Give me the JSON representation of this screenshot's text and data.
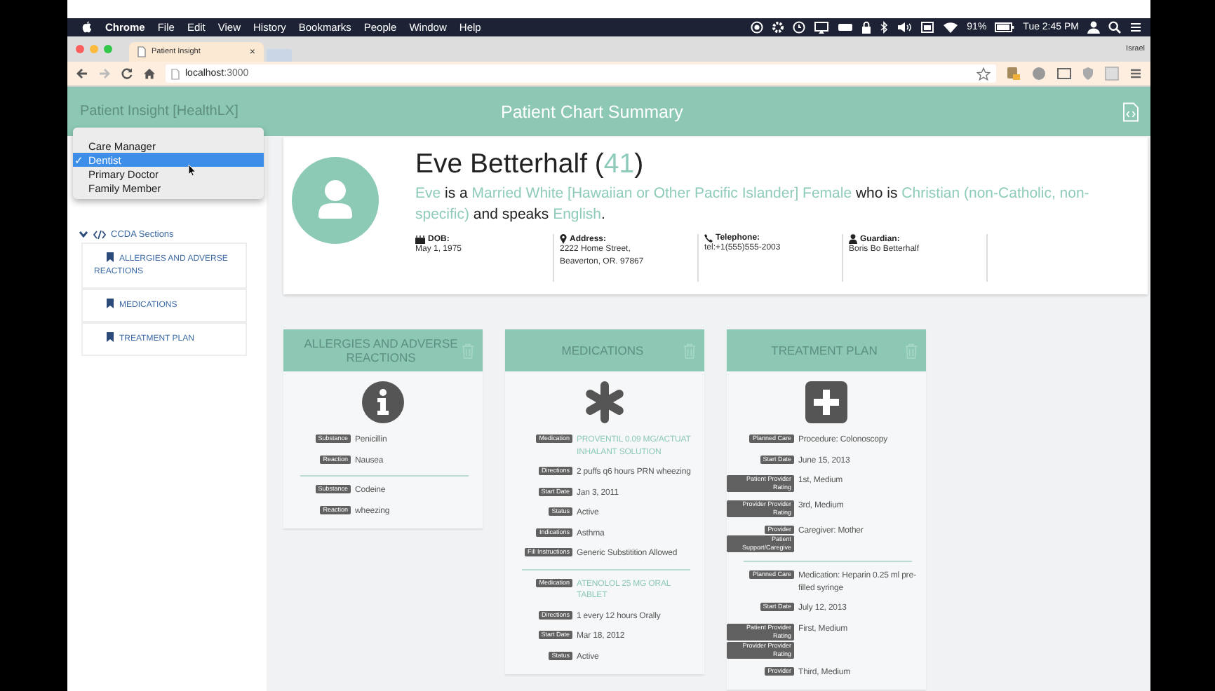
{
  "menubar": {
    "app": "Chrome",
    "items": [
      "File",
      "Edit",
      "View",
      "History",
      "Bookmarks",
      "People",
      "Window",
      "Help"
    ],
    "battery": "91%",
    "clock": "Tue 2:45 PM"
  },
  "browser": {
    "tab_title": "Patient Insight",
    "tab_close": "×",
    "profile": "Israel",
    "url": "**localhost**:3000"
  },
  "header": {
    "brand": "Patient Insight [HealthLX]",
    "title": "Patient Chart Summary"
  },
  "role_menu": {
    "options": [
      {
        "label": "Care Manager",
        "selected": false
      },
      {
        "label": "Dentist",
        "selected": true
      },
      {
        "label": "Primary Doctor",
        "selected": false
      },
      {
        "label": "Family Member",
        "selected": false
      }
    ],
    "check": "✓"
  },
  "sidebar": {
    "section": {
      "label": "CCDA Sections",
      "expanded": true,
      "children": [
        {
          "label": "ALLERGIES AND ADVERSE REACTIONS"
        },
        {
          "label": "MEDICATIONS"
        },
        {
          "label": "TREATMENT PLAN"
        }
      ]
    }
  },
  "patient": {
    "name": [
      {
        "text": "Eve Betterhalf (",
        "highlight": false
      },
      {
        "text": "41",
        "highlight": true
      },
      {
        "text": ")",
        "highlight": false
      }
    ],
    "summary": [
      {
        "text": "Eve",
        "highlight": true
      },
      {
        "text": " is a ",
        "highlight": false
      },
      {
        "text": "Married White [Hawaiian or Other Pacific Islander] Female",
        "highlight": true
      },
      {
        "text": "  who is ",
        "highlight": false
      },
      {
        "text": "Christian (non-Catholic, non-specific)",
        "highlight": true
      },
      {
        "text": "  and speaks ",
        "highlight": false
      },
      {
        "text": "English",
        "highlight": true
      },
      {
        "text": ".",
        "highlight": false
      }
    ],
    "details": [
      {
        "kind": "dob",
        "label": "DOB:",
        "lines": [
          "May 1, 1975"
        ]
      },
      {
        "kind": "address",
        "label": "Address:",
        "lines": [
          "2222 Home Street,",
          "Beaverton, OR. 97867"
        ]
      },
      {
        "kind": "phone",
        "label": "Telephone:",
        "lines": [
          "tel:+1(555)555-2003"
        ]
      },
      {
        "kind": "guardian",
        "label": "Guardian:",
        "lines": [
          "Boris Bo Betterhalf"
        ]
      }
    ]
  },
  "sections": [
    {
      "kind": "allergies",
      "title": "ALLERGIES AND ADVERSE REACTIONS",
      "entries": [
        [
          {
            "labels": [
              "Substance"
            ],
            "value": "Penicillin",
            "link": false
          },
          {
            "labels": [
              "Reaction"
            ],
            "value": "Nausea",
            "link": false
          }
        ],
        [
          {
            "labels": [
              "Substance"
            ],
            "value": "Codeine",
            "link": false
          },
          {
            "labels": [
              "Reaction"
            ],
            "value": "wheezing",
            "link": false
          }
        ]
      ]
    },
    {
      "kind": "medications",
      "title": "MEDICATIONS",
      "entries": [
        [
          {
            "labels": [
              "Medication"
            ],
            "value": "PROVENTIL 0.09 MG/ACTUAT INHALANT SOLUTION",
            "link": true
          },
          {
            "labels": [
              "Directions"
            ],
            "value": "2 puffs q6 hours PRN wheezing",
            "link": false
          },
          {
            "labels": [
              "Start Date"
            ],
            "value": "Jan 3, 2011",
            "link": false
          },
          {
            "labels": [
              "Status"
            ],
            "value": "Active",
            "link": false
          },
          {
            "labels": [
              "Indications"
            ],
            "value": "Asthma",
            "link": false
          },
          {
            "labels": [
              "Fill Instructions"
            ],
            "value": "Generic Substitition Allowed",
            "link": false
          }
        ],
        [
          {
            "labels": [
              "Medication"
            ],
            "value": "ATENOLOL 25 MG ORAL TABLET",
            "link": true
          },
          {
            "labels": [
              "Directions"
            ],
            "value": "1 every 12 hours Orally",
            "link": false
          },
          {
            "labels": [
              "Start Date"
            ],
            "value": "Mar 18, 2012",
            "link": false
          },
          {
            "labels": [
              "Status"
            ],
            "value": "Active",
            "link": false
          }
        ]
      ]
    },
    {
      "kind": "treatment",
      "title": "TREATMENT PLAN",
      "entries": [
        [
          {
            "labels": [
              "Planned Care"
            ],
            "value": "Procedure: Colonoscopy",
            "link": false
          },
          {
            "labels": [
              "Start Date"
            ],
            "value": "June 15, 2013",
            "link": false
          },
          {
            "labels": [
              "Patient Provider Rating"
            ],
            "value": "1st, Medium",
            "link": false
          },
          {
            "labels": [
              "Provider Provider Rating"
            ],
            "value": "3rd, Medium",
            "link": false
          },
          {
            "labels": [
              "Provider",
              "Patient Support/Caregive"
            ],
            "value": "Caregiver: Mother",
            "link": false
          }
        ],
        [
          {
            "labels": [
              "Planned Care"
            ],
            "value": "Medication: Heparin 0.25 ml pre-filled syringe",
            "link": false
          },
          {
            "labels": [
              "Start Date"
            ],
            "value": "July 12, 2013",
            "link": false
          },
          {
            "labels": [
              "Patient Provider Rating",
              "Provider Provider Rating"
            ],
            "value": "First, Medium",
            "link": false
          },
          {
            "labels": [
              "Provider"
            ],
            "value": "Third, Medium",
            "link": false
          }
        ]
      ]
    }
  ]
}
